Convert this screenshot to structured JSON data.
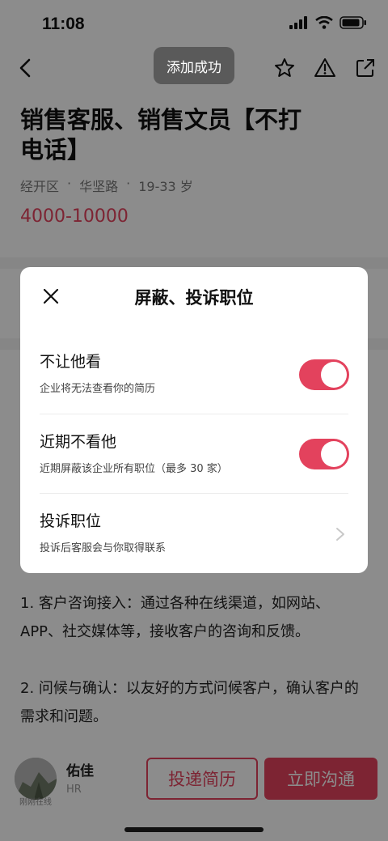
{
  "status_bar": {
    "time": "11:08"
  },
  "toast": {
    "text": "添加成功"
  },
  "job": {
    "title": "销售客服、销售文员【不打电话】",
    "location": "经开区",
    "street": "华坚路",
    "age": "19-33 岁",
    "salary": "4000-10000"
  },
  "description": {
    "p1": "1. 客户咨询接入：通过各种在线渠道，如网站、APP、社交媒体等，接收客户的咨询和反馈。",
    "p2": "2. 问候与确认：以友好的方式问候客户，确认客户的需求和问题。"
  },
  "recruiter": {
    "name": "佑佳",
    "role": "HR",
    "status": "刚刚在线"
  },
  "actions": {
    "resume_label": "投递简历",
    "chat_label": "立即沟通"
  },
  "modal": {
    "title": "屏蔽、投诉职位",
    "rows": [
      {
        "title": "不让他看",
        "subtitle": "企业将无法查看你的简历",
        "toggle_on": true
      },
      {
        "title": "近期不看他",
        "subtitle": "近期屏蔽该企业所有职位（最多 30 家）",
        "toggle_on": true
      },
      {
        "title": "投诉职位",
        "subtitle": "投诉后客服会与你取得联系"
      }
    ]
  },
  "colors": {
    "accent": "#e3425d",
    "overlay": "rgba(0,0,0,0.45)"
  }
}
